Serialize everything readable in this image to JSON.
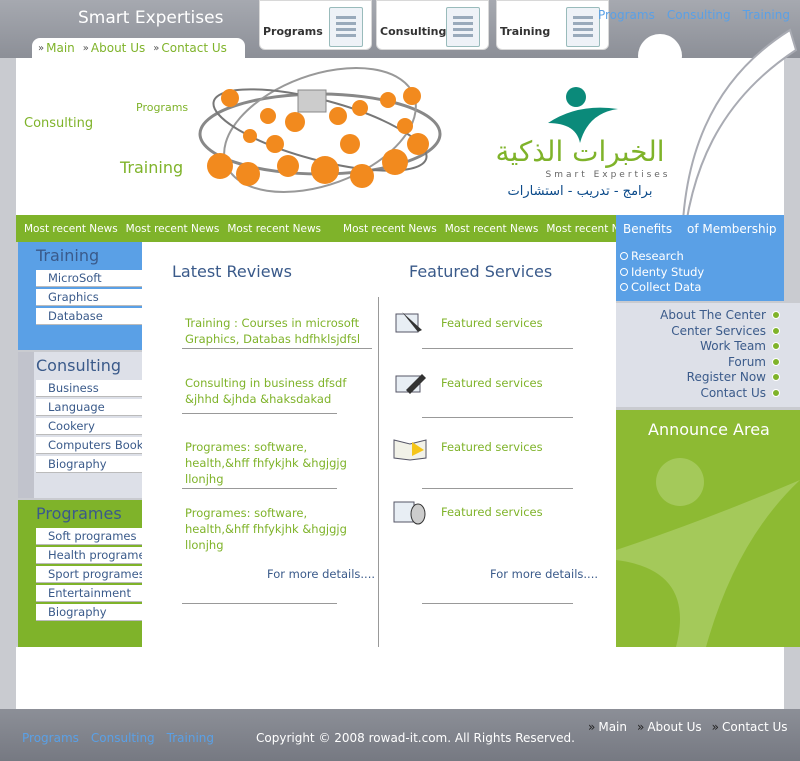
{
  "header": {
    "site_title": "Smart Expertises",
    "main_nav": [
      "Main",
      "About Us",
      "Contact Us"
    ],
    "tabs": [
      "Programs",
      "Consulting",
      "Training"
    ],
    "top_links": [
      "Programs",
      "Consulting",
      "Training"
    ]
  },
  "banner": {
    "words": {
      "consulting": "Consulting",
      "programs": "Programs",
      "training": "Training"
    },
    "logo_arabic": "الخبرات الذكية",
    "logo_english": "Smart Expertises",
    "logo_tagline": "برامج - تدريب - استشارات"
  },
  "news": [
    "Most recent News",
    "Most recent News",
    "Most recent News",
    "Most recent News",
    "Most recent News",
    "Most recent News"
  ],
  "sidebar": {
    "training": {
      "title": "Training",
      "items": [
        "MicroSoft",
        "Graphics",
        "Database"
      ]
    },
    "consulting": {
      "title": "Consulting",
      "items": [
        "Business",
        "Language",
        "Cookery",
        "Computers Books",
        "Biography"
      ]
    },
    "programes": {
      "title": "Programes",
      "items": [
        "Soft programes",
        "Health programes",
        "Sport programes",
        "Entertainment",
        "Biography"
      ]
    }
  },
  "reviews": {
    "title": "Latest Reviews",
    "items": [
      "Training : Courses  in microsoft Graphics, Databas hdfhklsjdfsl",
      "Consulting in business dfsdf &jhhd &jhda &haksdakad",
      "Programes: software, health,&hff fhfykjhk &hgjgjg llonjhg",
      "Programes: software, health,&hff fhfykjhk &hgjgjg llonjhg"
    ],
    "more": "For more details...."
  },
  "services": {
    "title": "Featured Services",
    "items": [
      "Featured services",
      "Featured services",
      "Featured services",
      "Featured services"
    ],
    "more": "For more details...."
  },
  "benefits": {
    "title_left": "Benefits",
    "title_right": "of Membership",
    "items": [
      "Research",
      "Identy Study",
      "Collect Data"
    ]
  },
  "right_menu": [
    "About The Center",
    "Center Services",
    "Work Team",
    "Forum",
    "Register Now",
    "Contact Us"
  ],
  "announce": {
    "title": "Announce Area"
  },
  "footer": {
    "left_links": [
      "Programs",
      "Consulting",
      "Training"
    ],
    "copyright": "Copyright © 2008 rowad-it.com. All Rights Reserved.",
    "right_links": [
      "Main",
      "About Us",
      "Contact Us"
    ]
  },
  "colors": {
    "green": "#7fb32a",
    "blue": "#5aa0e6",
    "navy": "#3a5a8a",
    "gray": "#8c8f97"
  }
}
